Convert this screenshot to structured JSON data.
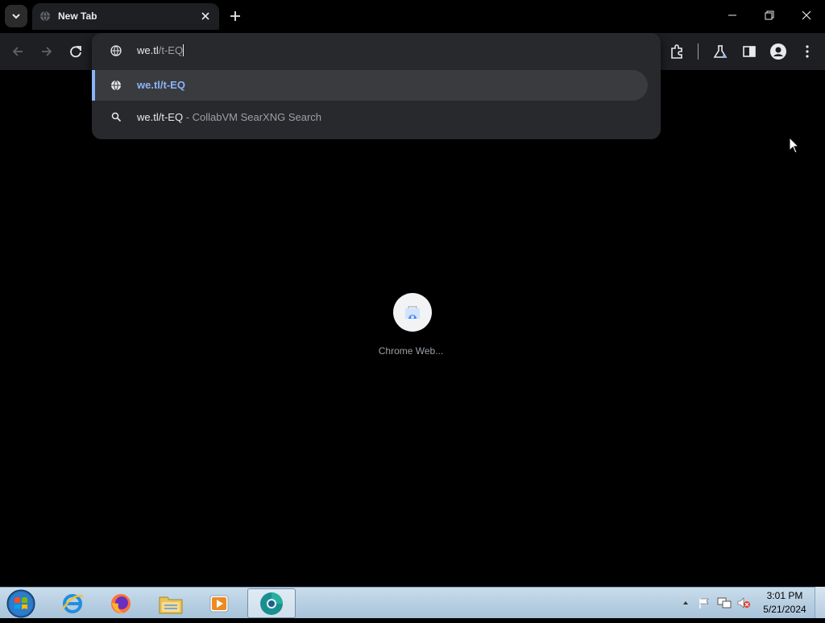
{
  "browser": {
    "tab": {
      "title": "New Tab"
    },
    "omnibox": {
      "input_typed": "we.tl",
      "input_autocomplete": "/t-EQ",
      "suggestions": [
        {
          "type": "url",
          "text": "we.tl/t-EQ"
        },
        {
          "type": "search",
          "text": "we.tl/t-EQ",
          "suffix": " - CollabVM SearXNG Search"
        }
      ]
    },
    "accent_color": "#8ab4f8"
  },
  "newtab": {
    "shortcut_label": "Chrome Web..."
  },
  "taskbar": {
    "time": "3:01 PM",
    "date": "5/21/2024",
    "apps": [
      "internet-explorer",
      "firefox",
      "file-explorer",
      "media-player",
      "chrome"
    ]
  }
}
